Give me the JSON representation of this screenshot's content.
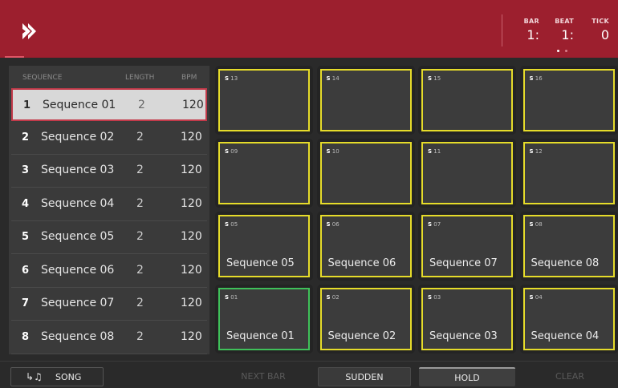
{
  "header": {
    "counters": [
      {
        "label": "BAR",
        "value": "1:"
      },
      {
        "label": "BEAT",
        "value": "1:"
      },
      {
        "label": "TICK",
        "value": "0"
      }
    ],
    "page_dots": 2,
    "active_dot": 0
  },
  "list": {
    "headers": {
      "sequence": "SEQUENCE",
      "length": "LENGTH",
      "bpm": "BPM"
    },
    "rows": [
      {
        "num": "1",
        "name": "Sequence 01",
        "length": "2",
        "bpm": "120",
        "selected": true
      },
      {
        "num": "2",
        "name": "Sequence 02",
        "length": "2",
        "bpm": "120"
      },
      {
        "num": "3",
        "name": "Sequence 03",
        "length": "2",
        "bpm": "120"
      },
      {
        "num": "4",
        "name": "Sequence 04",
        "length": "2",
        "bpm": "120"
      },
      {
        "num": "5",
        "name": "Sequence 05",
        "length": "2",
        "bpm": "120"
      },
      {
        "num": "6",
        "name": "Sequence 06",
        "length": "2",
        "bpm": "120"
      },
      {
        "num": "7",
        "name": "Sequence 07",
        "length": "2",
        "bpm": "120"
      },
      {
        "num": "8",
        "name": "Sequence 08",
        "length": "2",
        "bpm": "120"
      }
    ]
  },
  "pads": [
    {
      "id": "13",
      "name": ""
    },
    {
      "id": "14",
      "name": ""
    },
    {
      "id": "15",
      "name": ""
    },
    {
      "id": "16",
      "name": ""
    },
    {
      "id": "09",
      "name": ""
    },
    {
      "id": "10",
      "name": ""
    },
    {
      "id": "11",
      "name": ""
    },
    {
      "id": "12",
      "name": ""
    },
    {
      "id": "05",
      "name": "Sequence 05"
    },
    {
      "id": "06",
      "name": "Sequence 06"
    },
    {
      "id": "07",
      "name": "Sequence 07"
    },
    {
      "id": "08",
      "name": "Sequence 08"
    },
    {
      "id": "01",
      "name": "Sequence 01",
      "active": true
    },
    {
      "id": "02",
      "name": "Sequence 02"
    },
    {
      "id": "03",
      "name": "Sequence 03"
    },
    {
      "id": "04",
      "name": "Sequence 04"
    }
  ],
  "pad_prefix": "S",
  "bottom": {
    "song_label": "SONG",
    "song_icon": "return-note-icon",
    "next_bar": "NEXT BAR",
    "sudden": "SUDDEN",
    "hold": "HOLD",
    "clear": "CLEAR"
  },
  "colors": {
    "header": "#9c1f2e",
    "pad_border": "#e6dc2a",
    "pad_active_border": "#3fc15a",
    "selected_row_border": "#c23a4a"
  }
}
